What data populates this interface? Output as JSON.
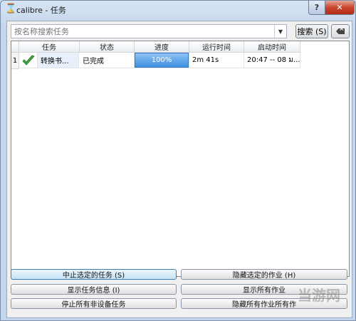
{
  "window": {
    "title": "calibre - 任务",
    "help_label": "?",
    "close_label": "✕"
  },
  "search": {
    "placeholder": "按名称搜索任务",
    "dropdown_icon": "chevron-down-icon",
    "search_button": "搜索 (S)",
    "clear_icon": "backspace-clear-icon"
  },
  "table": {
    "columns": [
      "任务",
      "状态",
      "进度",
      "运行时间",
      "启动时间"
    ],
    "rows": [
      {
        "index": "1",
        "icon": "checkmark-icon",
        "task": "转换书...",
        "status": "已完成",
        "progress_text": "100%",
        "progress": 1.0,
        "run_time": "2m 41s",
        "start_time": "20:47 -- 08 ม..."
      }
    ]
  },
  "buttons": {
    "abort_selected": "中止选定的任务 (S)",
    "hide_selected": "隐藏选定的作业 (H)",
    "show_info": "显示任务信息 (I)",
    "show_all": "显示所有作业",
    "stop_non_device": "停止所有非设备任务",
    "hide_all": "隐藏所有作业所有作"
  },
  "watermark": "当游网",
  "colors": {
    "progress": "#3d8ee0",
    "check": "#3da53d",
    "close": "#c8452d"
  }
}
